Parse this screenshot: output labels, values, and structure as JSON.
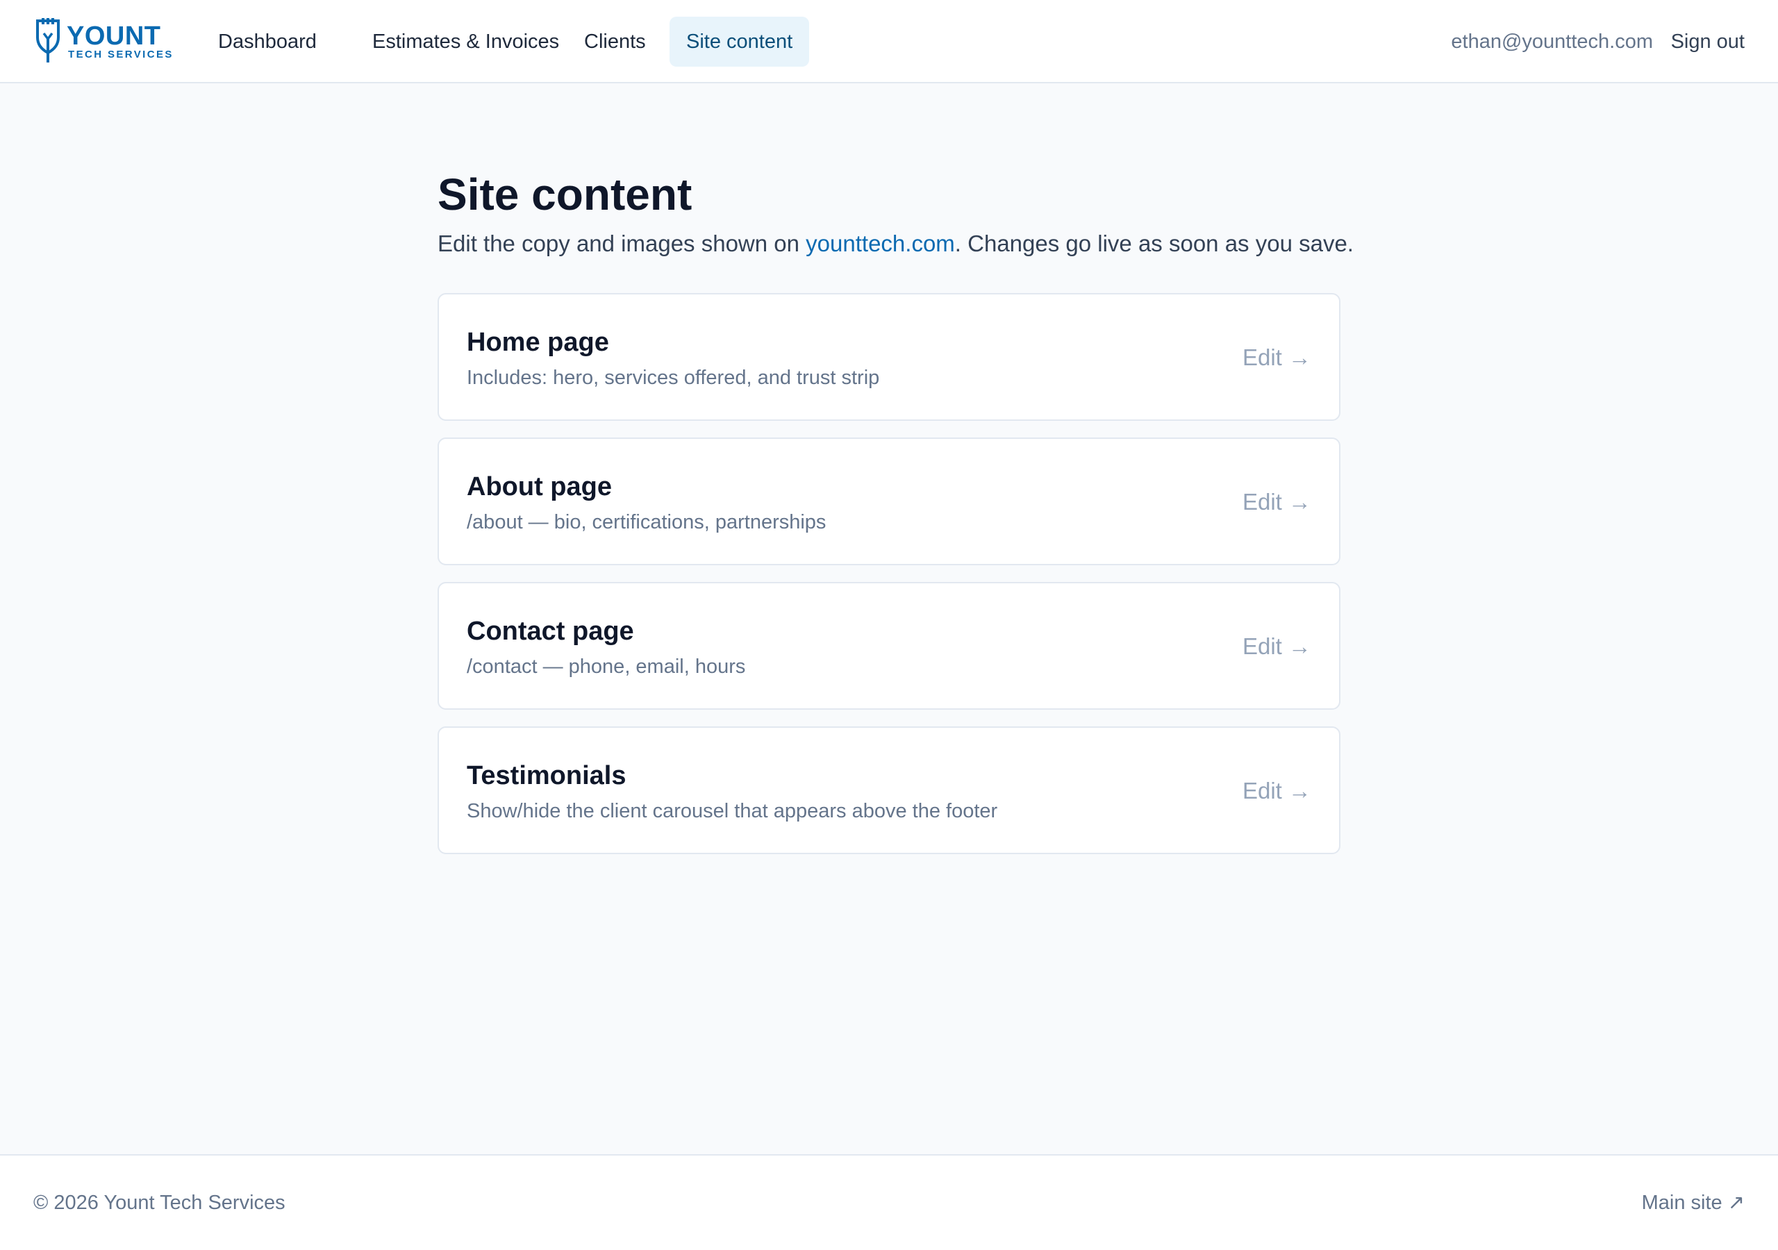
{
  "app": {
    "logo_word": "YOUNT",
    "logo_sub": "TECH SERVICES",
    "brand_color": "#0b6ab1"
  },
  "nav": {
    "items": [
      {
        "label": "Dashboard"
      },
      {
        "label": "Estimates & Invoices"
      },
      {
        "label": "Clients"
      },
      {
        "label": "Site content",
        "active": true
      }
    ]
  },
  "user": {
    "email": "ethan@younttech.com",
    "signout_label": "Sign out"
  },
  "page": {
    "title": "Site content",
    "subtitle_prefix": "Edit the copy and images shown on ",
    "subtitle_link": "younttech.com",
    "subtitle_suffix": ". Changes go live as soon as you save."
  },
  "cards": [
    {
      "title": "Home page",
      "desc": "Includes: hero, services offered, and trust strip",
      "action": "Edit →"
    },
    {
      "title": "About page",
      "desc": "/about — bio, certifications, partnerships",
      "action": "Edit →"
    },
    {
      "title": "Contact page",
      "desc": "/contact — phone, email, hours",
      "action": "Edit →"
    },
    {
      "title": "Testimonials",
      "desc": "Show/hide the client carousel that appears above the footer",
      "action": "Edit →"
    }
  ],
  "footer": {
    "copyright": "© 2026 Yount Tech Services",
    "main_site_label": "Main site ↗"
  }
}
